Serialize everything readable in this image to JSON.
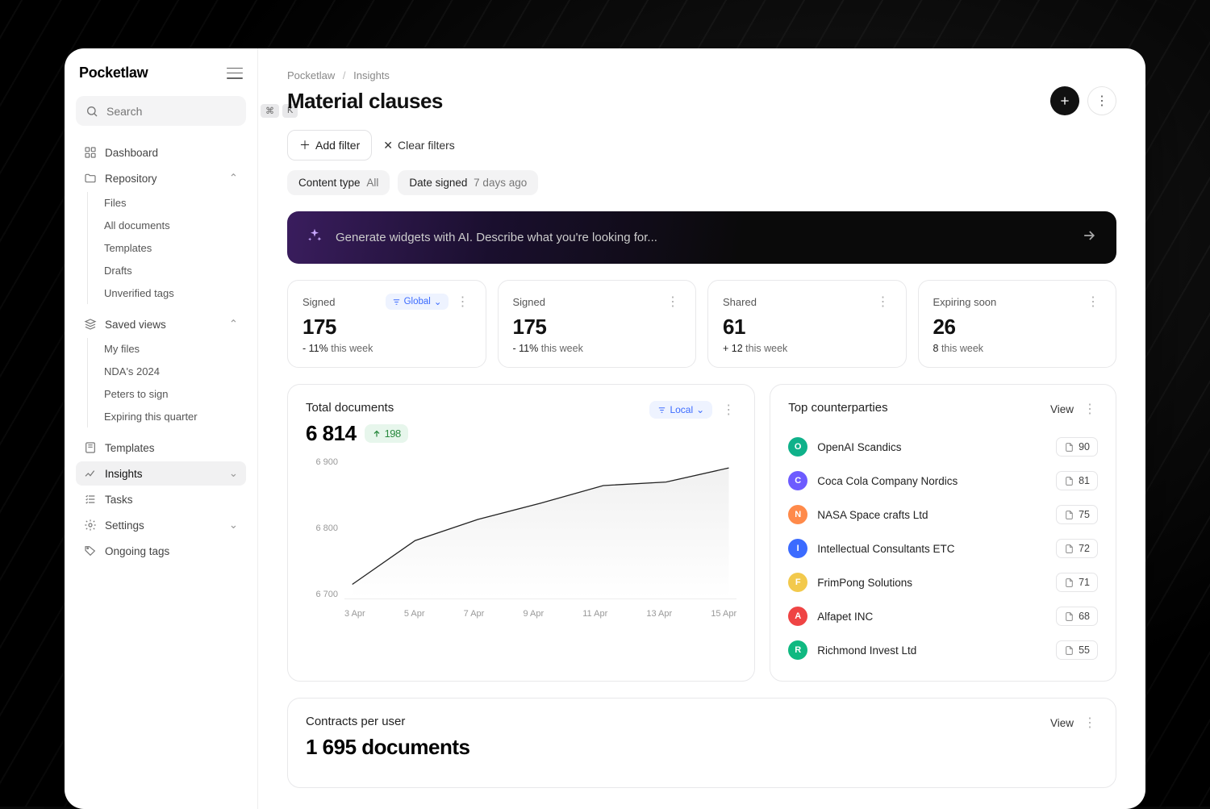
{
  "brand": "Pocketlaw",
  "search": {
    "placeholder": "Search",
    "kbd1": "⌘",
    "kbd2": "K"
  },
  "nav": {
    "dashboard": "Dashboard",
    "repository": "Repository",
    "repo_items": [
      "Files",
      "All documents",
      "Templates",
      "Drafts",
      "Unverified tags"
    ],
    "saved_views": "Saved views",
    "saved_items": [
      "My files",
      "NDA's 2024",
      "Peters to sign",
      "Expiring this quarter"
    ],
    "templates": "Templates",
    "insights": "Insights",
    "tasks": "Tasks",
    "settings": "Settings",
    "ongoing_tags": "Ongoing tags"
  },
  "crumb": {
    "root": "Pocketlaw",
    "leaf": "Insights"
  },
  "title": "Material clauses",
  "filters": {
    "add": "Add filter",
    "clear": "Clear filters",
    "chips": [
      {
        "label": "Content type",
        "value": "All"
      },
      {
        "label": "Date signed",
        "value": "7 days ago"
      }
    ]
  },
  "ai_prompt": "Generate widgets with AI. Describe what you're looking for...",
  "stats": [
    {
      "label": "Signed",
      "tag": "Global",
      "value": "175",
      "delta": "- 11%",
      "suffix": "this week"
    },
    {
      "label": "Signed",
      "value": "175",
      "delta": "- 11%",
      "suffix": "this week"
    },
    {
      "label": "Shared",
      "value": "61",
      "delta": "+ 12",
      "suffix": "this week"
    },
    {
      "label": "Expiring soon",
      "value": "26",
      "delta": "8",
      "suffix": "this week"
    }
  ],
  "total_docs": {
    "title": "Total documents",
    "value": "6 814",
    "badge": "198",
    "scope": "Local"
  },
  "chart_data": {
    "type": "line",
    "title": "Total documents",
    "ylabel": "",
    "xlabel": "",
    "ylim": [
      6700,
      6900
    ],
    "y_ticks": [
      "6 900",
      "6 800",
      "6 700"
    ],
    "categories": [
      "3 Apr",
      "5 Apr",
      "7 Apr",
      "9 Apr",
      "11 Apr",
      "13 Apr",
      "15 Apr"
    ],
    "values": [
      6720,
      6782,
      6812,
      6835,
      6860,
      6865,
      6885
    ]
  },
  "counterparties": {
    "title": "Top counterparties",
    "view": "View",
    "items": [
      {
        "initial": "O",
        "color": "#0fb18a",
        "name": "OpenAI Scandics",
        "count": 90
      },
      {
        "initial": "C",
        "color": "#6d5bff",
        "name": "Coca Cola Company Nordics",
        "count": 81
      },
      {
        "initial": "N",
        "color": "#ff8a4a",
        "name": "NASA Space crafts Ltd",
        "count": 75
      },
      {
        "initial": "I",
        "color": "#3b6bff",
        "name": "Intellectual Consultants ETC",
        "count": 72
      },
      {
        "initial": "F",
        "color": "#f2c94c",
        "name": "FrimPong Solutions",
        "count": 71
      },
      {
        "initial": "A",
        "color": "#ef4444",
        "name": "Alfapet INC",
        "count": 68
      },
      {
        "initial": "R",
        "color": "#10b981",
        "name": "Richmond Invest Ltd",
        "count": 55
      }
    ]
  },
  "contracts": {
    "title": "Contracts per user",
    "value": "1 695 documents",
    "view": "View"
  }
}
